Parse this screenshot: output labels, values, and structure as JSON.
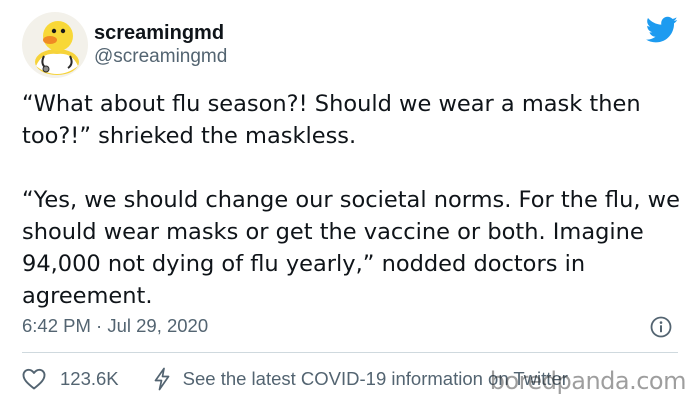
{
  "user": {
    "display_name": "screamingmd",
    "handle": "@screamingmd",
    "avatar_icon": "rubber-duck-doctor-avatar"
  },
  "brand": {
    "icon": "twitter-bird-icon",
    "color": "#1d9bf0"
  },
  "tweet": {
    "paragraphs": [
      "“What about flu season?! Should we wear a mask then too?!” shrieked the maskless.",
      "“Yes, we should change our societal norms. For the flu, we should wear masks or get the vaccine or both. Imagine 94,000 not dying of flu yearly,” nodded doctors in agreement."
    ],
    "timestamp": "6:42 PM · Jul 29, 2020"
  },
  "actions": {
    "like_icon": "heart-icon",
    "like_count": "123.6K",
    "covid_icon": "lightning-icon",
    "covid_label": "See the latest COVID-19 information on Twitter"
  },
  "info_icon": "info-icon",
  "watermark": "boredpanda.com",
  "colors": {
    "text_primary": "#0f1419",
    "text_secondary": "#536471",
    "divider": "#cfd9de"
  }
}
